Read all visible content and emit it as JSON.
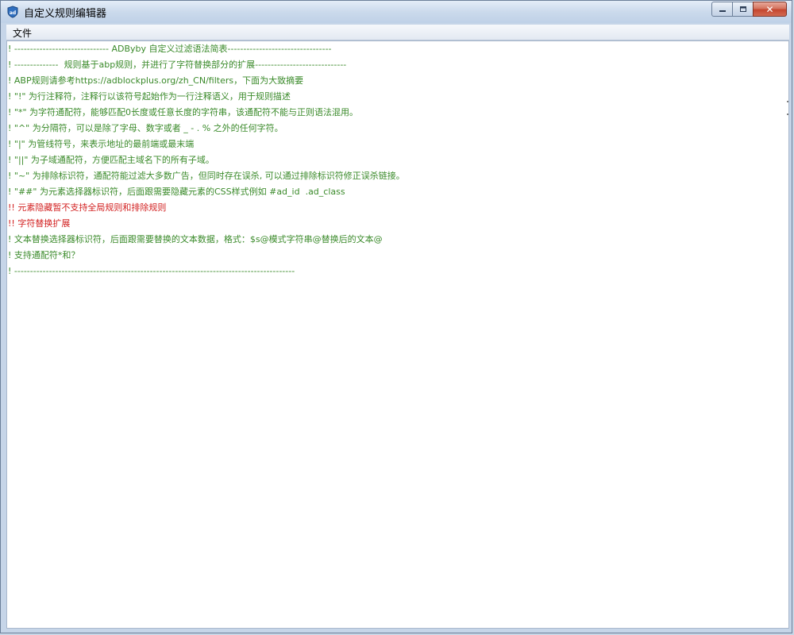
{
  "window": {
    "title": "自定义规则编辑器",
    "icon": "adbyby-shield-icon",
    "buttons": {
      "minimize_icon": "minimize-icon",
      "maximize_icon": "maximize-icon",
      "close_icon": "close-icon",
      "close_glyph": "✕"
    }
  },
  "menu": {
    "items": [
      {
        "label": "文件"
      }
    ]
  },
  "editor": {
    "colors": {
      "comment": "#3a8a2a",
      "highlight": "#d21f1f"
    },
    "lines": [
      {
        "text": "! ------------------------------ ADByby 自定义过滤语法简表---------------------------------",
        "style": "comment"
      },
      {
        "text": "! --------------  规则基于abp规则，并进行了字符替换部分的扩展-----------------------------",
        "style": "comment"
      },
      {
        "text": "! ABP规则请参考https://adblockplus.org/zh_CN/filters，下面为大致摘要",
        "style": "comment"
      },
      {
        "text": "! \"!\" 为行注释符，注释行以该符号起始作为一行注释语义，用于规则描述",
        "style": "comment"
      },
      {
        "text": "! \"*\" 为字符通配符，能够匹配0长度或任意长度的字符串，该通配符不能与正则语法混用。",
        "style": "comment"
      },
      {
        "text": "! \"^\" 为分隔符，可以是除了字母、数字或者 _ - . % 之外的任何字符。",
        "style": "comment"
      },
      {
        "text": "! \"|\" 为管线符号，来表示地址的最前端或最末端",
        "style": "comment"
      },
      {
        "text": "! \"||\" 为子域通配符，方便匹配主域名下的所有子域。",
        "style": "comment"
      },
      {
        "text": "! \"~\" 为排除标识符，通配符能过滤大多数广告，但同时存在误杀, 可以通过排除标识符修正误杀链接。",
        "style": "comment"
      },
      {
        "text": "! \"##\" 为元素选择器标识符，后面跟需要隐藏元素的CSS样式例如 #ad_id  .ad_class",
        "style": "comment"
      },
      {
        "text": "!! 元素隐藏暂不支持全局规则和排除规则",
        "style": "red"
      },
      {
        "text": "!! 字符替换扩展",
        "style": "red"
      },
      {
        "text": "! 文本替换选择器标识符，后面跟需要替换的文本数据，格式：$s@模式字符串@替换后的文本@",
        "style": "comment"
      },
      {
        "text": "! 支持通配符*和？",
        "style": "comment"
      },
      {
        "text": "! -----------------------------------------------------------------------------------------",
        "style": "comment"
      }
    ]
  }
}
